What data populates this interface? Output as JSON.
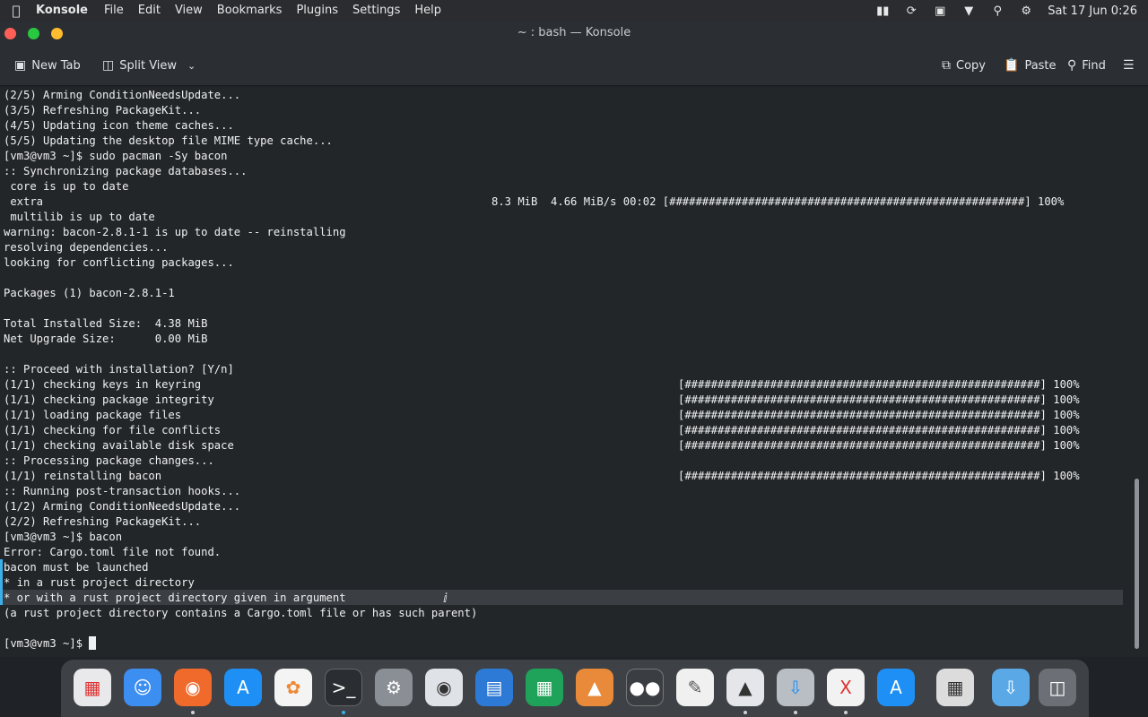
{
  "menubar": {
    "app_name": "Konsole",
    "menus": [
      "File",
      "Edit",
      "View",
      "Bookmarks",
      "Plugins",
      "Settings",
      "Help"
    ],
    "clock": "Sat 17 Jun 0:26"
  },
  "window": {
    "title": "~ : bash — Konsole"
  },
  "toolbar": {
    "new_tab": "New Tab",
    "split_view": "Split View",
    "copy": "Copy",
    "paste": "Paste",
    "find": "Find"
  },
  "terminal": {
    "lines": [
      "(2/5) Arming ConditionNeedsUpdate...",
      "(3/5) Refreshing PackageKit...",
      "(4/5) Updating icon theme caches...",
      "(5/5) Updating the desktop file MIME type cache...",
      "[vm3@vm3 ~]$ sudo pacman -Sy bacon",
      ":: Synchronizing package databases...",
      " core is up to date",
      " extra",
      " multilib is up to date",
      "warning: bacon-2.8.1-1 is up to date -- reinstalling",
      "resolving dependencies...",
      "looking for conflicting packages...",
      "",
      "Packages (1) bacon-2.8.1-1",
      "",
      "Total Installed Size:  4.38 MiB",
      "Net Upgrade Size:      0.00 MiB",
      "",
      ":: Proceed with installation? [Y/n]",
      "(1/1) checking keys in keyring",
      "(1/1) checking package integrity",
      "(1/1) loading package files",
      "(1/1) checking for file conflicts",
      "(1/1) checking available disk space",
      ":: Processing package changes...",
      "(1/1) reinstalling bacon",
      ":: Running post-transaction hooks...",
      "(1/2) Arming ConditionNeedsUpdate...",
      "(2/2) Refreshing PackageKit...",
      "[vm3@vm3 ~]$ bacon",
      "Error: Cargo.toml file not found.",
      "bacon must be launched",
      "* in a rust project directory",
      "* or with a rust project directory given in argument",
      "(a rust project directory contains a Cargo.toml file or has such parent)",
      "",
      "[vm3@vm3 ~]$ "
    ],
    "extra_progress": "8.3 MiB  4.66 MiB/s 00:02 [######################################################] 100%",
    "progress_bar": "[######################################################] 100%"
  }
}
